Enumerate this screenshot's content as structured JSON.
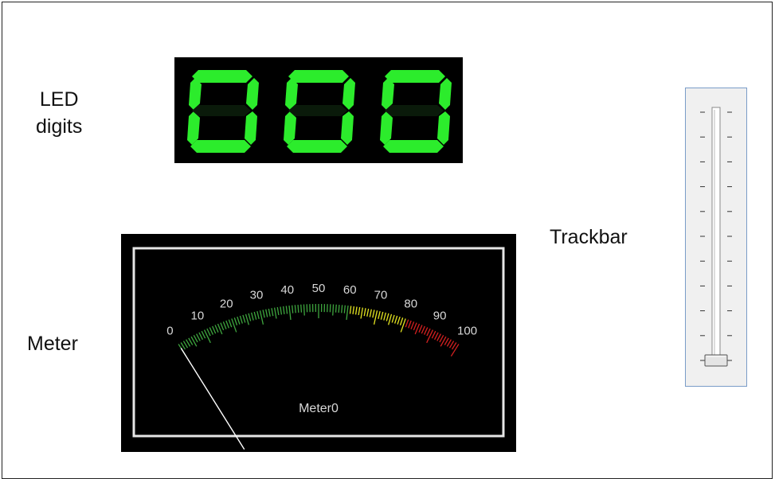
{
  "labels": {
    "led_line1": "LED",
    "led_line2": "digits",
    "meter": "Meter",
    "trackbar": "Trackbar"
  },
  "led": {
    "digits": [
      "0",
      "0",
      "0"
    ],
    "color": "#2cec2c",
    "background": "#000000"
  },
  "meter": {
    "caption": "Meter0",
    "value": 0,
    "min": 0,
    "max": 100,
    "scale_labels": [
      "0",
      "10",
      "20",
      "30",
      "40",
      "50",
      "60",
      "70",
      "80",
      "90",
      "100"
    ],
    "zones": [
      {
        "from": 0,
        "to": 60,
        "color": "#3ea53e"
      },
      {
        "from": 60,
        "to": 80,
        "color": "#e3e320"
      },
      {
        "from": 80,
        "to": 100,
        "color": "#d42020"
      }
    ],
    "label_color": "#d8d8d8",
    "needle_color": "#ffffff"
  },
  "trackbar": {
    "value": 0,
    "min": 0,
    "max": 10,
    "orientation": "vertical",
    "border_color": "#7a9cc8"
  }
}
